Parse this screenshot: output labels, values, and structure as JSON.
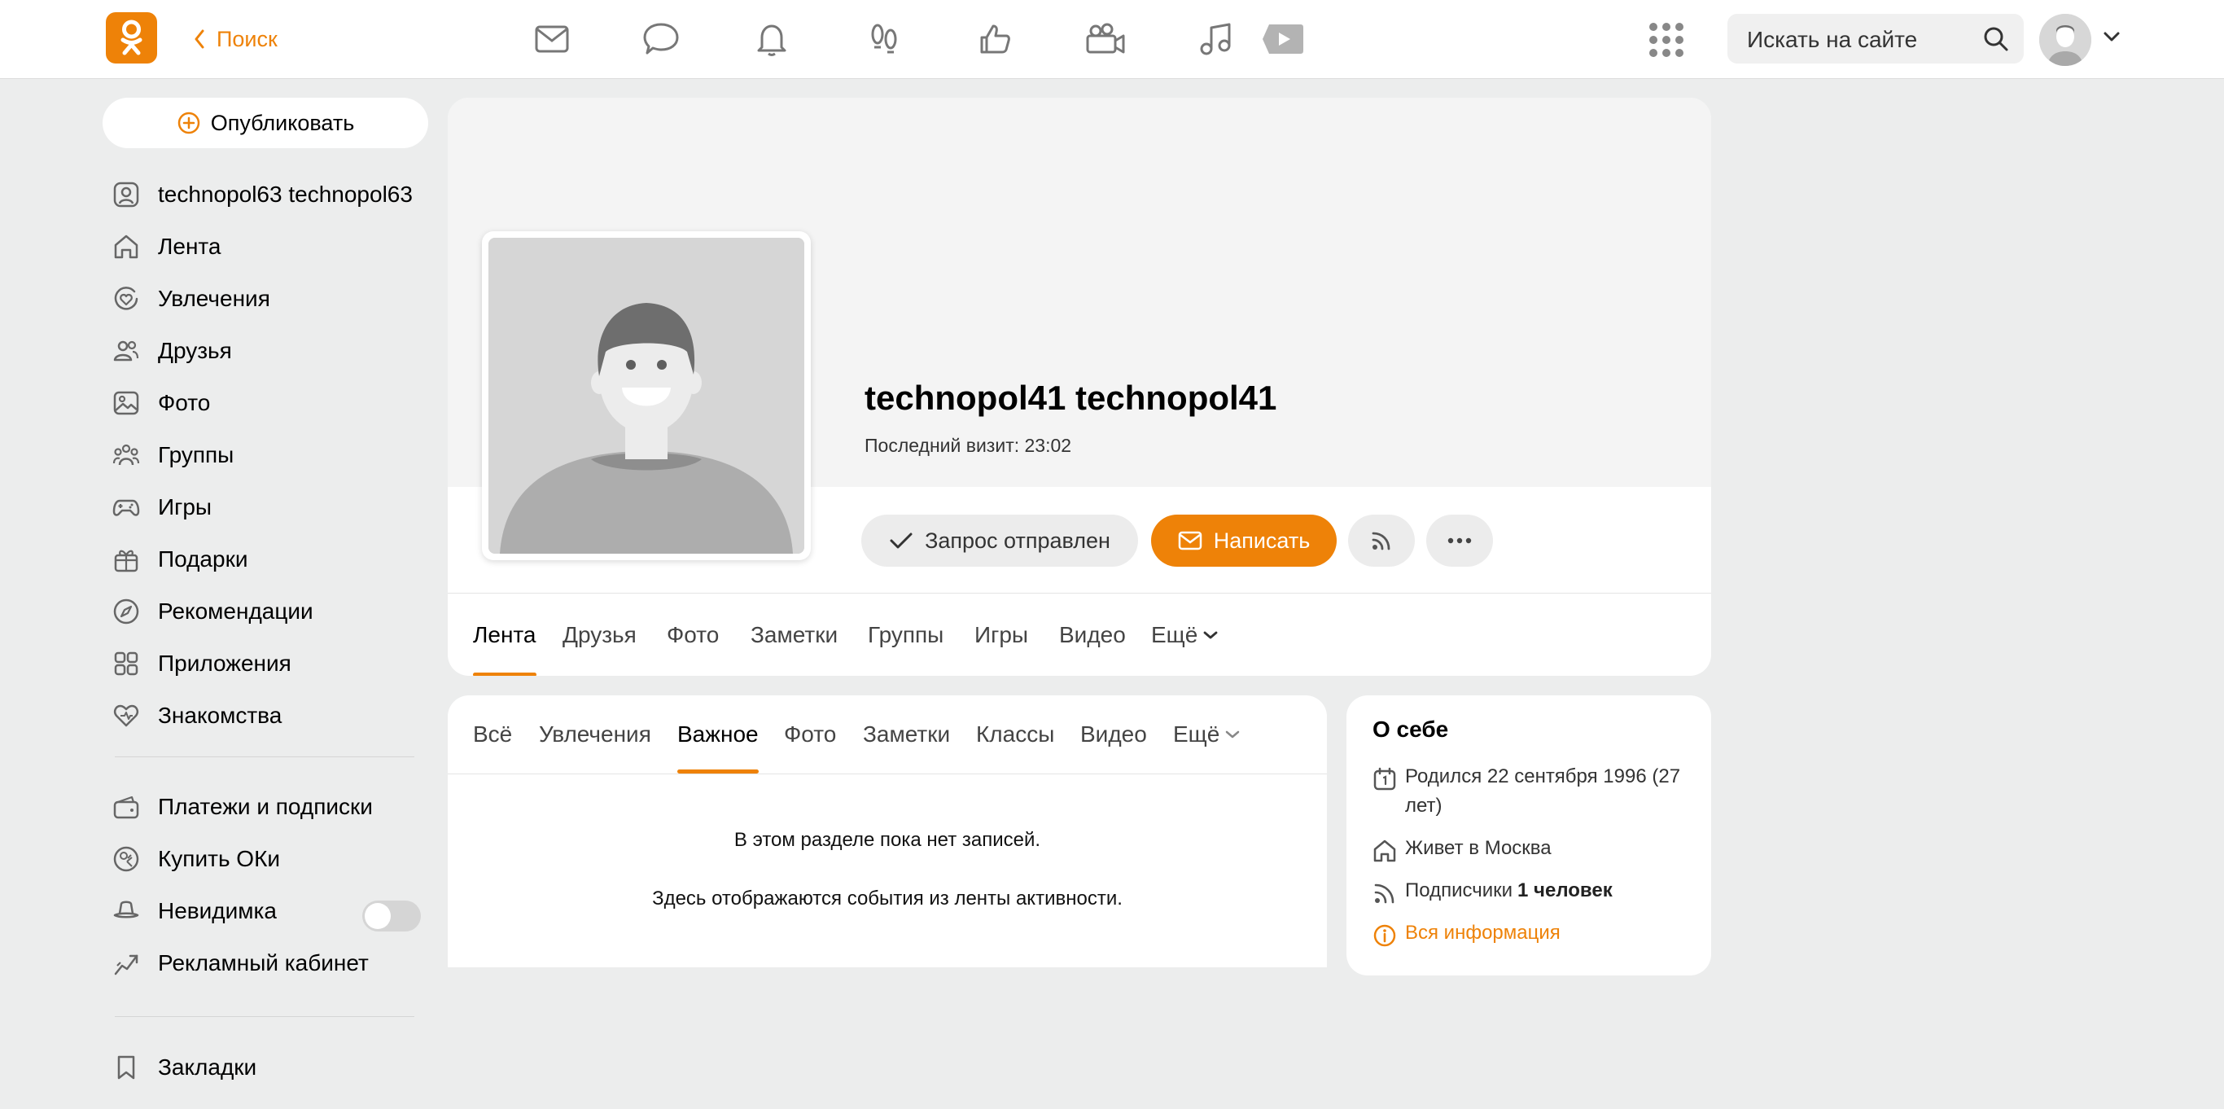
{
  "header": {
    "back_label": "Поиск",
    "search": {
      "placeholder": "Искать на сайте"
    },
    "nav_icons": [
      "message-icon",
      "discussions-icon",
      "notifications-icon",
      "guests-icon",
      "likes-icon",
      "video-calls-icon",
      "music-icon",
      "video-icon"
    ]
  },
  "sidebar": {
    "publish_label": "Опубликовать",
    "items": [
      {
        "label": "technopol63 technopol63",
        "icon": "user-profile-icon"
      },
      {
        "label": "Лента",
        "icon": "home-icon"
      },
      {
        "label": "Увлечения",
        "icon": "hobbies-icon"
      },
      {
        "label": "Друзья",
        "icon": "friends-icon"
      },
      {
        "label": "Фото",
        "icon": "photo-icon"
      },
      {
        "label": "Группы",
        "icon": "groups-icon"
      },
      {
        "label": "Игры",
        "icon": "gamepad-icon"
      },
      {
        "label": "Подарки",
        "icon": "gift-icon"
      },
      {
        "label": "Рекомендации",
        "icon": "compass-icon"
      },
      {
        "label": "Приложения",
        "icon": "apps-grid-icon"
      },
      {
        "label": "Знакомства",
        "icon": "dating-heart-icon"
      }
    ],
    "items2": [
      {
        "label": "Платежи и подписки",
        "icon": "wallet-icon"
      },
      {
        "label": "Купить ОКи",
        "icon": "coins-icon"
      },
      {
        "label": "Невидимка",
        "icon": "incognito-hat-icon"
      },
      {
        "label": "Рекламный кабинет",
        "icon": "ads-chart-icon"
      }
    ],
    "items3": [
      {
        "label": "Закладки",
        "icon": "bookmark-icon"
      }
    ],
    "invisible_toggle_on": false
  },
  "profile": {
    "name": "technopol41 technopol41",
    "last_visit": "Последний визит: 23:02",
    "request_label": "Запрос отправлен",
    "write_label": "Написать",
    "tabs": [
      "Лента",
      "Друзья",
      "Фото",
      "Заметки",
      "Группы",
      "Игры",
      "Видео",
      "Ещё"
    ],
    "active_tab": "Лента"
  },
  "feed": {
    "tabs": [
      "Всё",
      "Увлечения",
      "Важное",
      "Фото",
      "Заметки",
      "Классы",
      "Видео",
      "Ещё"
    ],
    "active_tab": "Важное",
    "empty_line1": "В этом разделе пока нет записей.",
    "empty_line2": "Здесь отображаются события из ленты активности."
  },
  "about": {
    "title": "О себе",
    "birth": "Родился 22 сентября 1996 (27 лет)",
    "lives_prefix": "Живет в",
    "lives_city": "Москва",
    "followers_prefix": "Подписчики",
    "followers_count": "1 человек",
    "all_info": "Вся информация"
  },
  "colors": {
    "accent": "#ee8208",
    "background": "#eceded",
    "card": "#ffffff"
  }
}
